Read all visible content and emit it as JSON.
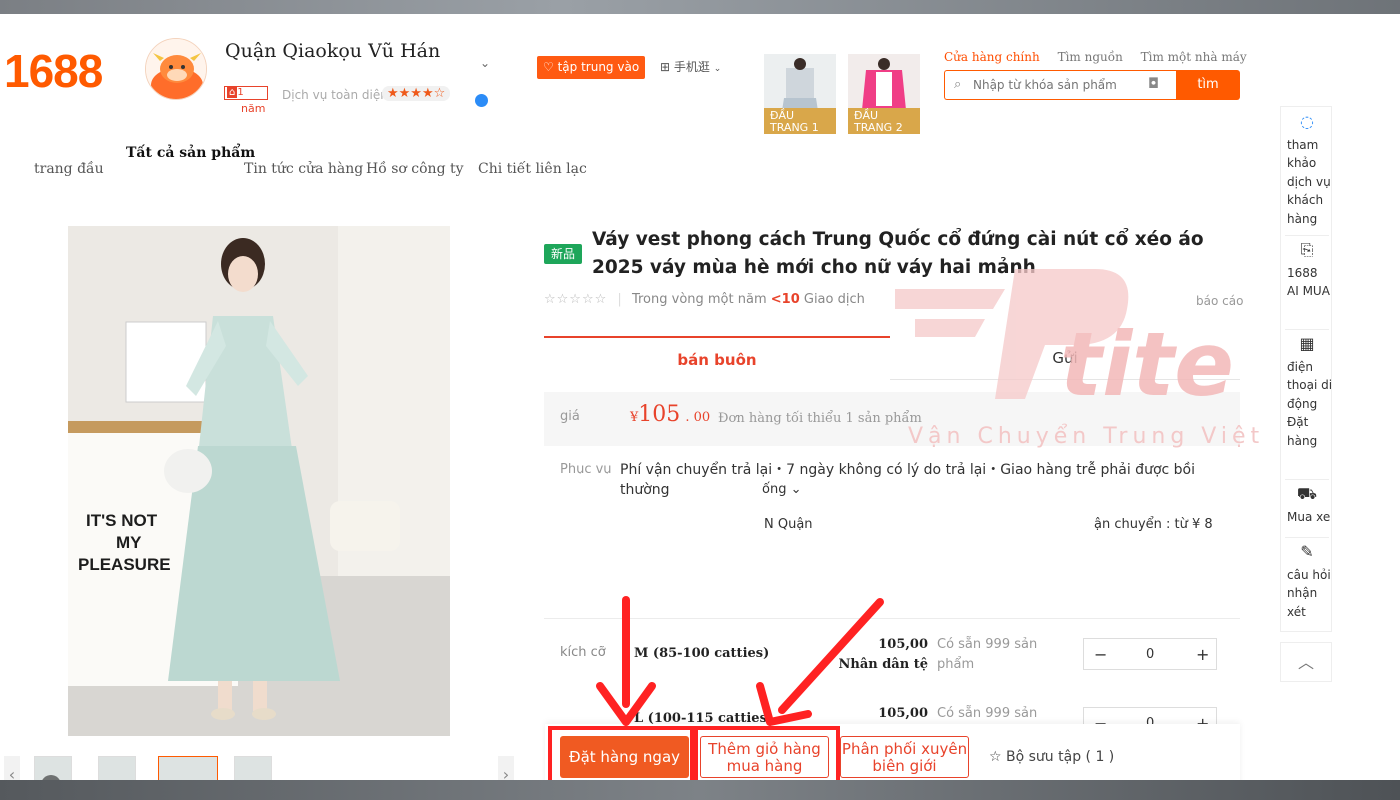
{
  "header": {
    "logo": "1688",
    "shop_name": "Quận Qiaokọu Vũ Hán",
    "year_num": "1",
    "year_unit": "năm",
    "service_label": "Dịch vụ toàn diện",
    "service_stars": "★★★★☆",
    "focus_button": "tập trung vào",
    "mobile_link": "手机逛",
    "thumb_cards": [
      {
        "label": "ĐẦU TRANG 1"
      },
      {
        "label": "ĐẦU TRANG 2"
      }
    ],
    "search_tabs": [
      "Cửa hàng chính",
      "Tìm nguồn",
      "Tìm một nhà máy"
    ],
    "search_placeholder": "Nhập từ khóa sản phẩm",
    "search_button": "tìm"
  },
  "nav": {
    "home": "trang đầu",
    "all_products": "Tất cả sản phẩm",
    "news": "Tin tức cửa hàng",
    "profile": "Hồ sơ công ty",
    "contact": "Chi tiết liên lạc"
  },
  "product": {
    "new_badge": "新品",
    "title": "Váy vest phong cách Trung Quốc cổ đứng cài nút cổ xéo áo 2025 váy mùa hè mới cho nữ váy hai mảnh",
    "rating_stars": "☆☆☆☆☆",
    "transactions_prefix": "Trong vòng một năm",
    "transactions_count": "<10",
    "transactions_suffix": "Giao dịch",
    "report": "báo cáo",
    "tab_wholesale": "bán buôn",
    "tab_send": "Gửi",
    "price_label": "giá",
    "price_currency": "¥",
    "price_int": "105",
    "price_dec": ". 00",
    "min_order": "Đơn hàng tối thiểu 1 sản phẩm",
    "service_label": "Phục vụ",
    "service_text": "Phí vận chuyển trả lại・7 ngày không có lý do trả lại・Giao hàng trễ phải được bồi thường",
    "service_more": "ống ⌄",
    "ship_from": "N Quận",
    "ship_fee": "ận chuyển : từ ¥ 8",
    "size_label": "kích cỡ",
    "variants": [
      {
        "size": "M (85-100 catties)",
        "price": "105,00",
        "currency": "Nhân dân tệ",
        "stock": "Có sẵn 999 sản phẩm",
        "qty": "0"
      },
      {
        "size": "L (100-115 catties)",
        "price": "105,00",
        "currency": "",
        "stock": "Có sẵn 999 sản",
        "qty": "0"
      }
    ]
  },
  "actions": {
    "buy_now": "Đặt hàng ngay",
    "add_cart": "Thêm giỏ hàng mua hàng",
    "cross_border": "Phân phối xuyên biên giới",
    "collection": "Bộ sưu tập ( 1 )"
  },
  "sidebar": {
    "items": [
      {
        "icon": "chat-icon",
        "label": "tham khảo dịch vụ khách hàng"
      },
      {
        "icon": "ai-icon",
        "label": "1688 AI MUA"
      },
      {
        "icon": "qr-icon",
        "label": "điện thoại di động Đặt hàng"
      },
      {
        "icon": "cart-icon",
        "label": "Mua xe"
      },
      {
        "icon": "edit-icon",
        "label": "câu hỏi nhận xét"
      }
    ],
    "back_to_top": "︿"
  },
  "watermark": {
    "brand": "tite",
    "tagline": "Vận Chuyển Trung Việt"
  },
  "colors": {
    "accent": "#ff5a00",
    "price": "#e8432b",
    "highlight": "#ff2222"
  }
}
